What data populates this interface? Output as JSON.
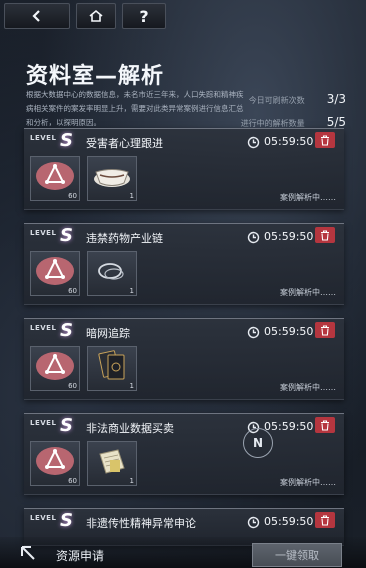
{
  "nav": {
    "back_icon": "back-arrow-icon",
    "home_icon": "home-icon",
    "help_label": "?"
  },
  "page": {
    "title": "资料室—解析",
    "description": "根据大数据中心的数据信息，未名市近三年来，人口失踪和精神疾病相关案件的案发率明显上升，需要对此类异常案例进行信息汇总和分析，以探明原因。"
  },
  "stats": [
    {
      "label": "今日可刷新次数",
      "value": "3/3"
    },
    {
      "label": "进行中的解析数量",
      "value": "5/5"
    }
  ],
  "cases": [
    {
      "level_label": "LEVEL",
      "level": "S",
      "name": "受害者心理跟进",
      "time": "05:59:50",
      "items": [
        {
          "icon": "triangle-token-icon",
          "count": "60"
        },
        {
          "icon": "teacup-icon",
          "count": "1"
        }
      ],
      "status": "案例解析中……"
    },
    {
      "level_label": "LEVEL",
      "level": "S",
      "name": "违禁药物产业链",
      "time": "05:59:50",
      "items": [
        {
          "icon": "triangle-token-icon",
          "count": "60"
        },
        {
          "icon": "necklace-icon",
          "count": "1"
        }
      ],
      "status": "案例解析中……"
    },
    {
      "level_label": "LEVEL",
      "level": "S",
      "name": "暗网追踪",
      "time": "05:59:50",
      "items": [
        {
          "icon": "triangle-token-icon",
          "count": "60"
        },
        {
          "icon": "cards-icon",
          "count": "1"
        }
      ],
      "status": "案例解析中……"
    },
    {
      "level_label": "LEVEL",
      "level": "S",
      "name": "非法商业数据买卖",
      "time": "05:59:50",
      "items": [
        {
          "icon": "triangle-token-icon",
          "count": "60"
        },
        {
          "icon": "documents-icon",
          "count": "1"
        }
      ],
      "status": "案例解析中……"
    },
    {
      "level_label": "LEVEL",
      "level": "S",
      "name": "非遗传性精神异常申论",
      "time": "05:59:50"
    }
  ],
  "compass_label": "N",
  "footer": {
    "apply_label": "资源申请",
    "claim_label": "一键领取"
  },
  "colors": {
    "delete": "#b5363f",
    "level_glow": "#b98fd0"
  }
}
